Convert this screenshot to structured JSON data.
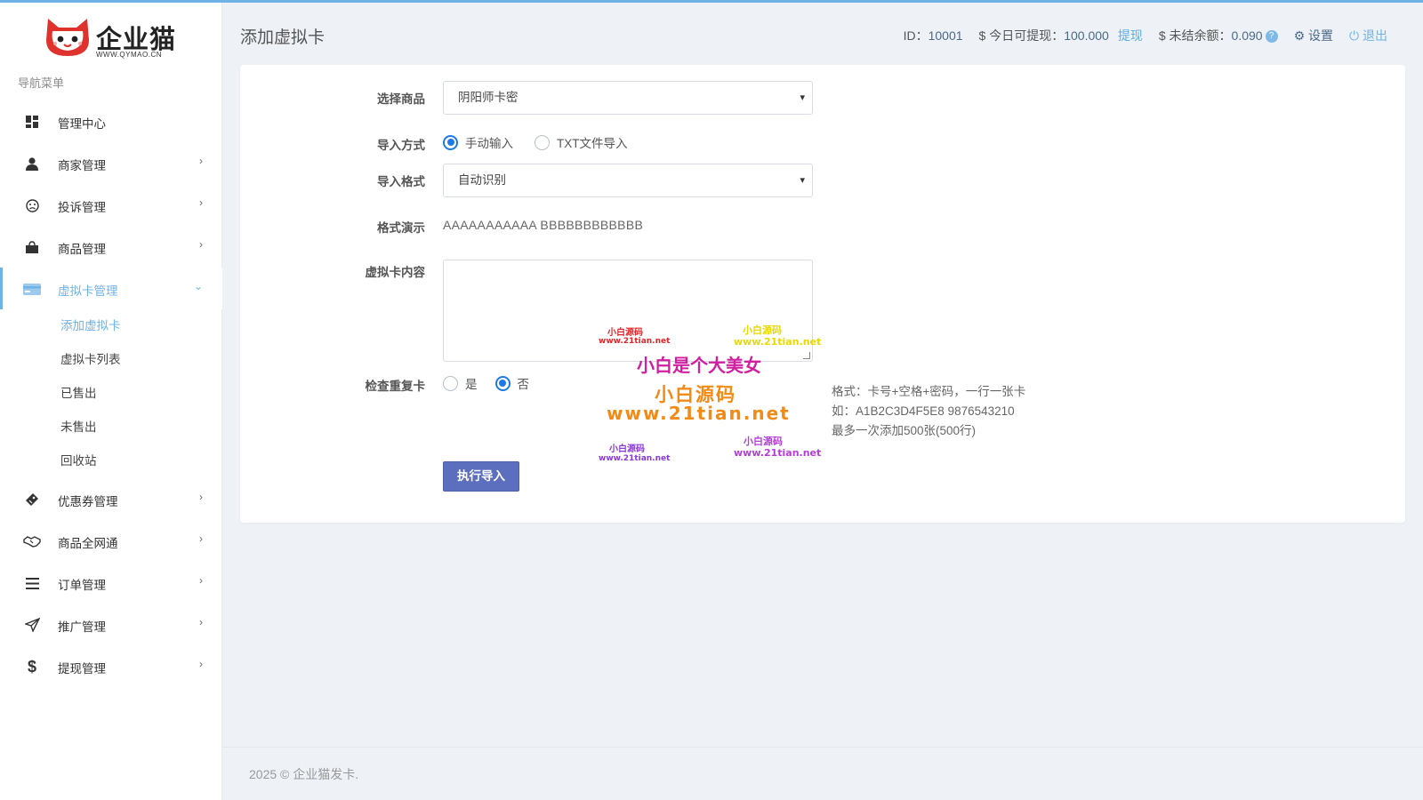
{
  "brand": {
    "name": "企业猫",
    "url": "WWW.QYMAO.CN",
    "accent": "#6fb3e6"
  },
  "sidebar": {
    "caption": "导航菜单",
    "items": [
      {
        "label": "管理中心",
        "icon": "dashboard-icon",
        "has_arrow": false
      },
      {
        "label": "商家管理",
        "icon": "user-icon",
        "has_arrow": true
      },
      {
        "label": "投诉管理",
        "icon": "frown-icon",
        "has_arrow": true
      },
      {
        "label": "商品管理",
        "icon": "shopping-bag-icon",
        "has_arrow": true
      },
      {
        "label": "虚拟卡管理",
        "icon": "credit-card-icon",
        "has_arrow": true,
        "active": true
      },
      {
        "label": "优惠券管理",
        "icon": "ticket-icon",
        "has_arrow": true
      },
      {
        "label": "商品全网通",
        "icon": "handshake-icon",
        "has_arrow": true
      },
      {
        "label": "订单管理",
        "icon": "list-icon",
        "has_arrow": true
      },
      {
        "label": "推广管理",
        "icon": "paper-plane-icon",
        "has_arrow": true
      },
      {
        "label": "提现管理",
        "icon": "dollar-icon",
        "has_arrow": true
      }
    ],
    "subitems": [
      "添加虚拟卡",
      "虚拟卡列表",
      "已售出",
      "未售出",
      "回收站"
    ]
  },
  "header": {
    "title": "添加虚拟卡",
    "id_label": "ID：",
    "id_value": "10001",
    "withdraw_label": "$ 今日可提现：",
    "withdraw_value": "100.000",
    "withdraw_link": "提现",
    "unsettled_label": "$ 未结余额：",
    "unsettled_value": "0.090",
    "help_mark": "?",
    "settings": "设置",
    "logout": "退出"
  },
  "form": {
    "product_label": "选择商品",
    "product_value": "阴阳师卡密",
    "import_method_label": "导入方式",
    "import_method_options": [
      "手动输入",
      "TXT文件导入"
    ],
    "import_method_selected": "手动输入",
    "import_format_label": "导入格式",
    "import_format_value": "自动识别",
    "format_demo_label": "格式演示",
    "format_demo_value": "AAAAAAAAAAA BBBBBBBBBBBB",
    "content_label": "虚拟卡内容",
    "content_value": "",
    "check_dup_label": "检查重复卡",
    "check_dup_options": [
      "是",
      "否"
    ],
    "check_dup_selected": "否",
    "hint_lines": [
      "格式：卡号+空格+密码，一行一张卡",
      "如：A1B2C3D4F5E8 9876543210",
      "最多一次添加500张(500行)"
    ],
    "submit_label": "执行导入"
  },
  "watermark": {
    "small_cn": "小白源码",
    "small_url": "www.21tian.net",
    "tagline": "小白是个大美女",
    "big_cn": "小白源码",
    "big_url": "www.21tian.net"
  },
  "footer": {
    "text": "2025 © 企业猫发卡."
  }
}
